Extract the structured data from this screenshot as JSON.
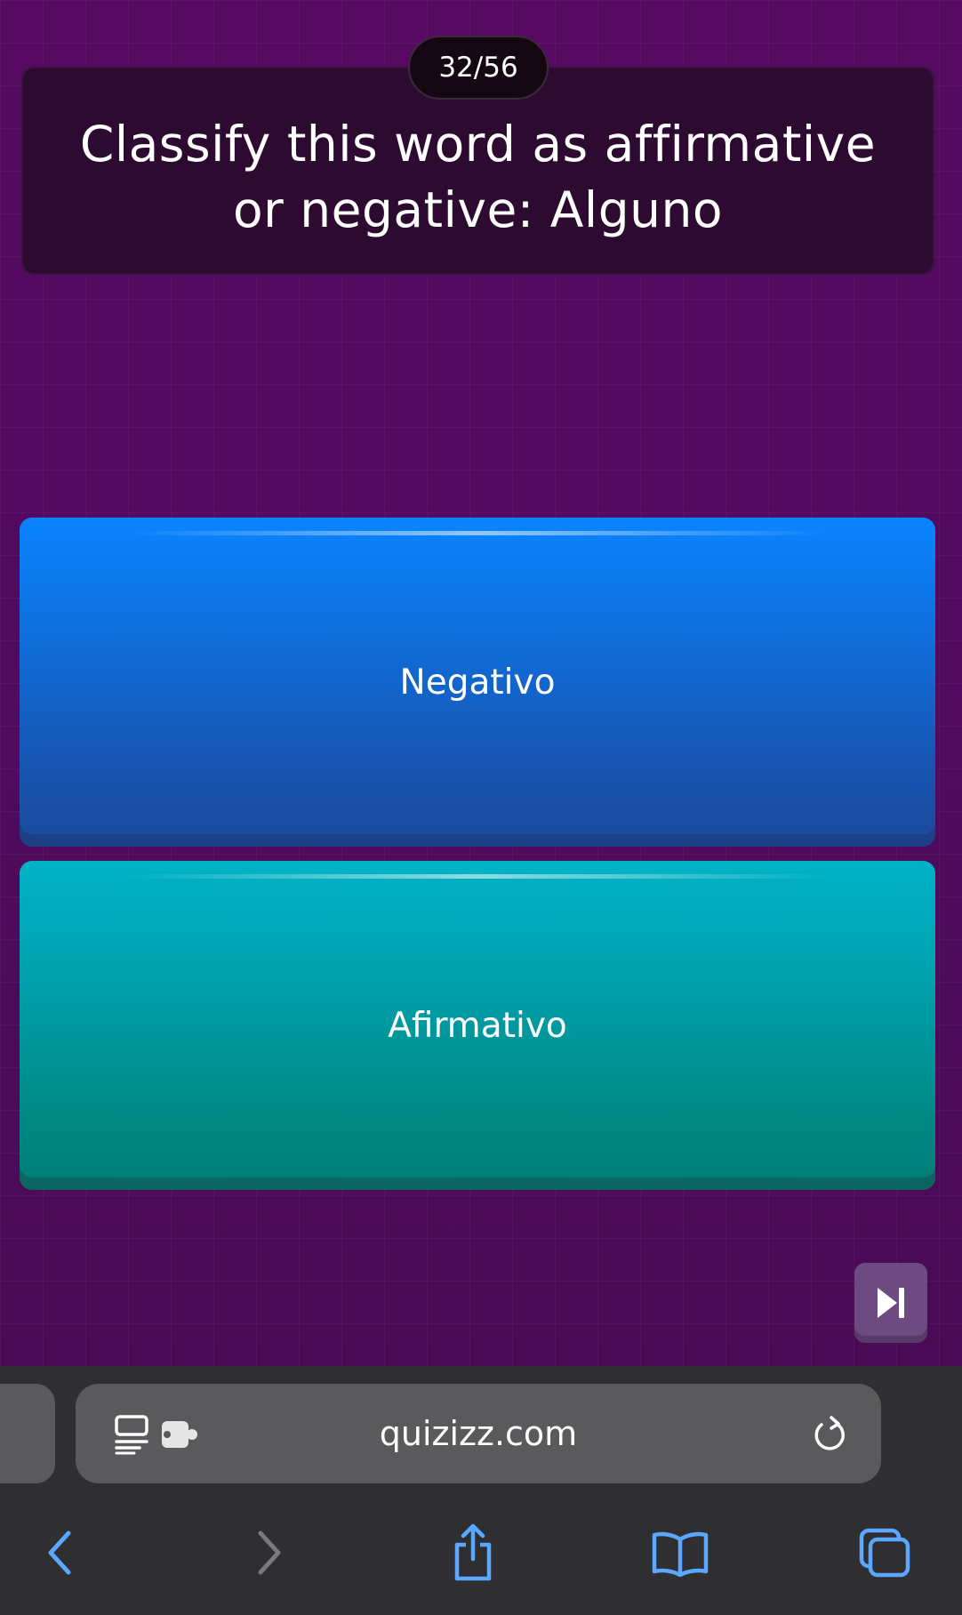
{
  "quiz": {
    "counter": "32/56",
    "question": "Classify this word as affirmative or negative: Alguno",
    "answers": [
      {
        "label": "Negativo",
        "color": "#0a84ff"
      },
      {
        "label": "Afirmativo",
        "color": "#00a1ae"
      }
    ],
    "skip_icon": "skip-forward-icon"
  },
  "browser": {
    "url": "quizizz.com",
    "icons": [
      "reader-mode-icon",
      "extension-icon",
      "reload-icon",
      "back-icon",
      "forward-icon",
      "share-icon",
      "bookmarks-icon",
      "tabs-icon"
    ],
    "accent": "#5aa8ff"
  },
  "colors": {
    "background": "#520a60",
    "question_card": "#2d0a30"
  }
}
